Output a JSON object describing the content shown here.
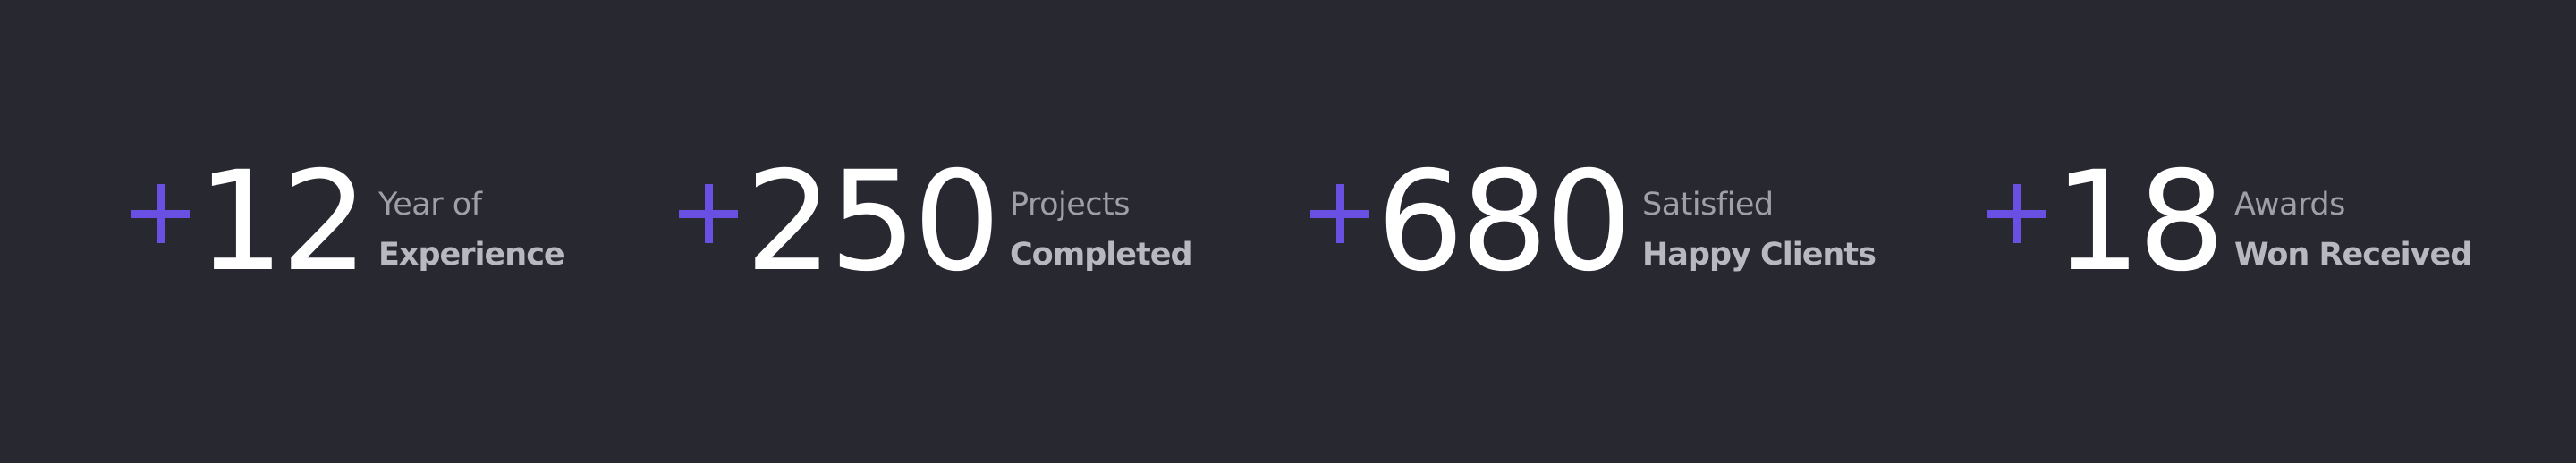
{
  "stats": [
    {
      "prefix": "+",
      "number": "12",
      "line1": "Year of",
      "line2": "Experience"
    },
    {
      "prefix": "+",
      "number": "250",
      "line1": "Projects",
      "line2": "Completed"
    },
    {
      "prefix": "+",
      "number": "680",
      "line1": "Satisfied",
      "line2": "Happy Clients"
    },
    {
      "prefix": "+",
      "number": "18",
      "line1": "Awards",
      "line2": "Won Received"
    }
  ],
  "colors": {
    "background": "#272830",
    "accent": "#6a4fe3",
    "number": "#ffffff",
    "label_light": "#9e9fa8",
    "label_bold": "#b8b9c0"
  },
  "icons": {
    "prefix": "plus-icon"
  }
}
